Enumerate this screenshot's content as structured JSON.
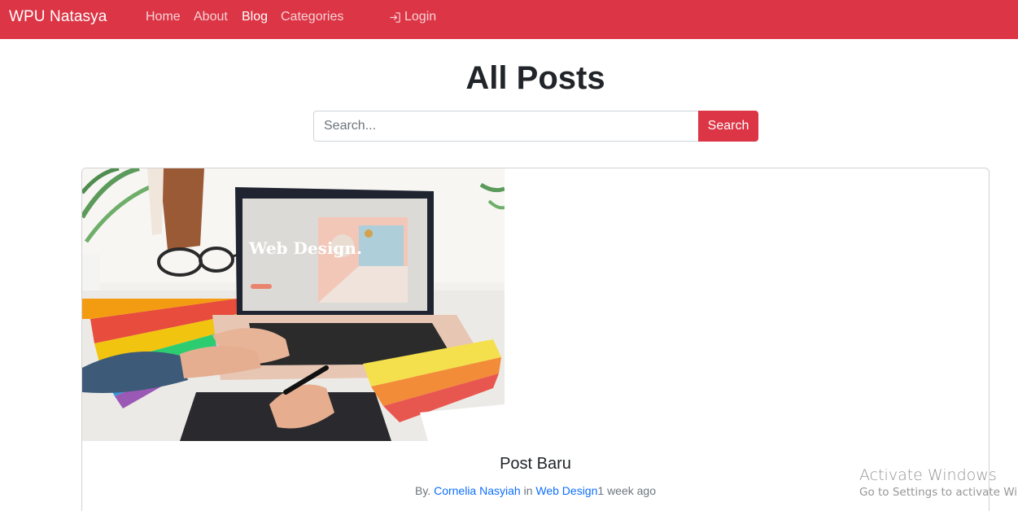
{
  "navbar": {
    "brand": "WPU Natasya",
    "links": [
      {
        "label": "Home",
        "active": false
      },
      {
        "label": "About",
        "active": false
      },
      {
        "label": "Blog",
        "active": true
      },
      {
        "label": "Categories",
        "active": false
      }
    ],
    "login_label": "Login",
    "login_icon": "login-arrow-icon",
    "background_color": "#dc3545"
  },
  "page": {
    "title": "All Posts"
  },
  "search": {
    "placeholder": "Search...",
    "value": "",
    "button_label": "Search"
  },
  "post": {
    "image_subject": "laptop-web-design-illustration",
    "image_text": "Web Design.",
    "title": "Post Baru",
    "by_label": "By.",
    "author": "Cornelia Nasyiah",
    "in_label": "in",
    "category": "Web Design",
    "time_ago": "1 week ago"
  },
  "watermark": {
    "title": "Activate Windows",
    "subtitle": "Go to Settings to activate Windows."
  },
  "colors": {
    "accent": "#dc3545",
    "link": "#0d6efd",
    "muted_text": "#6c757d"
  }
}
